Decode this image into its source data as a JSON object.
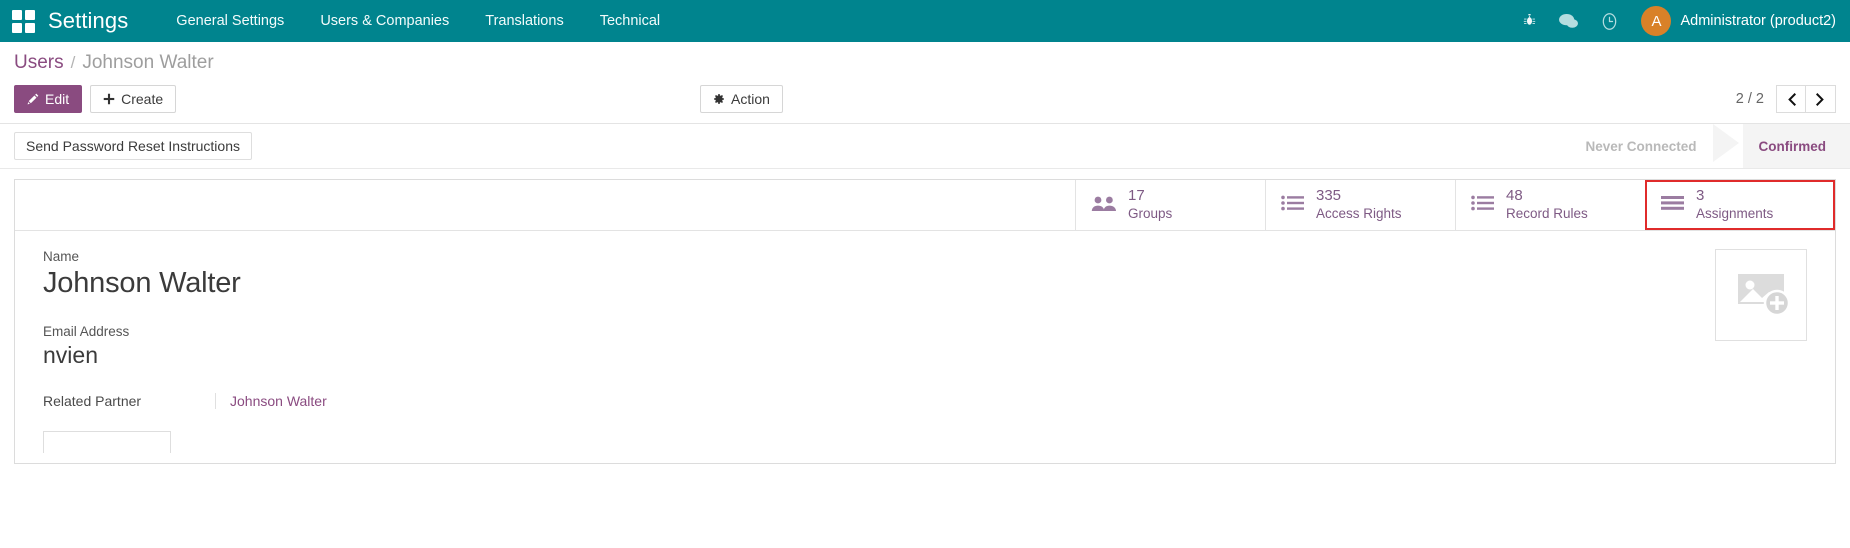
{
  "navbar": {
    "apps_icon": "apps-grid-icon",
    "brand": "Settings",
    "menu": [
      {
        "label": "General Settings"
      },
      {
        "label": "Users & Companies"
      },
      {
        "label": "Translations"
      },
      {
        "label": "Technical"
      }
    ],
    "icons": [
      {
        "name": "debug-bug-icon"
      },
      {
        "name": "messages-chat-icon"
      },
      {
        "name": "activities-clock-icon"
      }
    ],
    "user": {
      "avatar_letter": "A",
      "name": "Administrator (product2)"
    },
    "bg_color": "#00848e",
    "avatar_color": "#d98128"
  },
  "breadcrumb": {
    "root": "Users",
    "separator": "/",
    "current": "Johnson Walter"
  },
  "toolbar": {
    "edit_label": "Edit",
    "edit_icon": "pencil-icon",
    "create_label": "Create",
    "create_icon": "plus-icon",
    "action_label": "Action",
    "action_icon": "gear-icon"
  },
  "pager": {
    "count": "2 / 2",
    "prev_icon": "chevron-left-icon",
    "next_icon": "chevron-right-icon"
  },
  "statusbar_row": {
    "button_label": "Send Password Reset Instructions",
    "states": [
      {
        "label": "Never Connected",
        "active": false
      },
      {
        "label": "Confirmed",
        "active": true
      }
    ],
    "active_color": "#8a4b80"
  },
  "stat_buttons": [
    {
      "value": "17",
      "label": "Groups",
      "icon": "users-group-icon",
      "highlighted": false
    },
    {
      "value": "335",
      "label": "Access Rights",
      "icon": "list-lines-icon",
      "highlighted": false
    },
    {
      "value": "48",
      "label": "Record Rules",
      "icon": "list-lines-icon",
      "highlighted": false
    },
    {
      "value": "3",
      "label": "Assignments",
      "icon": "list-bars-icon",
      "highlighted": true
    }
  ],
  "highlight_color": "#e02b2b",
  "form": {
    "name": {
      "label": "Name",
      "value": "Johnson Walter"
    },
    "email": {
      "label": "Email Address",
      "value": "nvien"
    },
    "related_partner": {
      "label": "Related Partner",
      "value": "Johnson Walter"
    },
    "avatar_placeholder_icon": "image-add-placeholder-icon"
  }
}
